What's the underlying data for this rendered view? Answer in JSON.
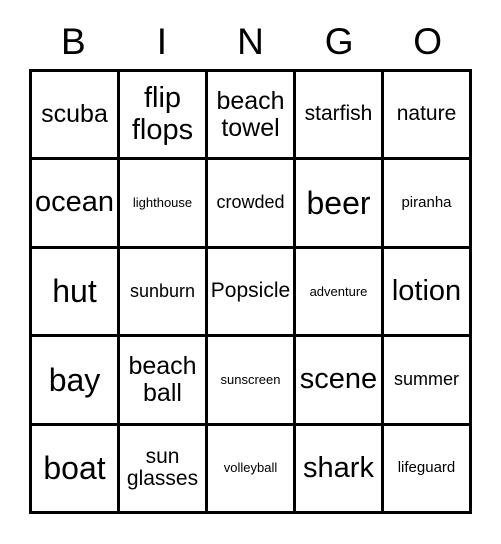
{
  "card": {
    "title": "BINGO",
    "columns": [
      {
        "letter": "B"
      },
      {
        "letter": "I"
      },
      {
        "letter": "N"
      },
      {
        "letter": "G"
      },
      {
        "letter": "O"
      }
    ],
    "rows": [
      {
        "cells": [
          {
            "text": "scuba",
            "size": "lg"
          },
          {
            "text": "flip\nflops",
            "size": "xl"
          },
          {
            "text": "beach\ntowel",
            "size": "lg"
          },
          {
            "text": "starfish",
            "size": "md"
          },
          {
            "text": "nature",
            "size": "md"
          }
        ]
      },
      {
        "cells": [
          {
            "text": "ocean",
            "size": "xl"
          },
          {
            "text": "lighthouse",
            "size": "xxs"
          },
          {
            "text": "crowded",
            "size": "sm"
          },
          {
            "text": "beer",
            "size": "xxl"
          },
          {
            "text": "piranha",
            "size": "xs"
          }
        ]
      },
      {
        "cells": [
          {
            "text": "hut",
            "size": "xxl"
          },
          {
            "text": "sunburn",
            "size": "sm"
          },
          {
            "text": "Popsicle",
            "size": "md"
          },
          {
            "text": "adventure",
            "size": "xxs"
          },
          {
            "text": "lotion",
            "size": "xl"
          }
        ]
      },
      {
        "cells": [
          {
            "text": "bay",
            "size": "xxl"
          },
          {
            "text": "beach\nball",
            "size": "lg"
          },
          {
            "text": "sunscreen",
            "size": "xxs"
          },
          {
            "text": "scene",
            "size": "xl"
          },
          {
            "text": "summer",
            "size": "sm"
          }
        ]
      },
      {
        "cells": [
          {
            "text": "boat",
            "size": "xxl"
          },
          {
            "text": "sun\nglasses",
            "size": "md"
          },
          {
            "text": "volleyball",
            "size": "xxs"
          },
          {
            "text": "shark",
            "size": "xl"
          },
          {
            "text": "lifeguard",
            "size": "xs"
          }
        ]
      }
    ],
    "colors": {
      "border": "#000000",
      "background": "#ffffff",
      "text": "#000000"
    }
  }
}
